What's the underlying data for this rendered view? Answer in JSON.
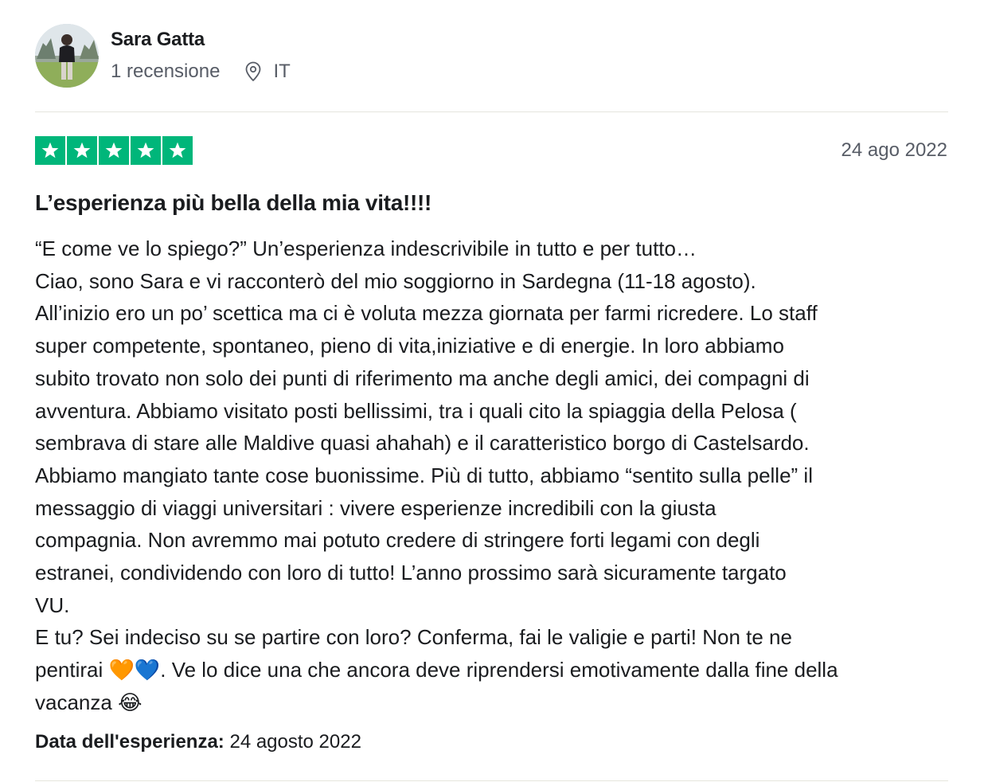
{
  "consumer": {
    "name": "Sara Gatta",
    "review_count": "1 recensione",
    "country": "IT"
  },
  "review": {
    "rating": 5,
    "rating_max": 5,
    "star_color": "#00b67a",
    "date": "24 ago 2022",
    "title": "L’esperienza più bella della mia vita!!!!",
    "body_lines": [
      "“E come ve lo spiego?” Un’esperienza indescrivibile in tutto e per tutto…",
      "Ciao, sono Sara e vi racconterò del mio soggiorno in Sardegna (11-18 agosto).",
      "All’inizio ero un po’ scettica ma ci è voluta mezza giornata per farmi ricredere. Lo staff",
      "super competente, spontaneo, pieno di vita,iniziative e di energie. In loro abbiamo",
      "subito trovato non solo dei punti di riferimento ma anche degli amici, dei compagni di",
      "avventura. Abbiamo visitato posti bellissimi, tra i quali cito la spiaggia della Pelosa (",
      "sembrava di stare alle Maldive quasi ahahah) e il caratteristico borgo di Castelsardo.",
      "Abbiamo mangiato tante cose buonissime. Più di tutto, abbiamo “sentito sulla pelle” il",
      "messaggio di viaggi universitari : vivere esperienze incredibili con la giusta",
      "compagnia. Non avremmo mai potuto credere di stringere forti legami con degli",
      "estranei, condividendo con loro di tutto! L’anno prossimo sarà sicuramente targato",
      "VU.",
      "E tu? Sei indeciso su se partire con loro? Conferma, fai le valigie e parti! Non te ne",
      "pentirai 🧡💙. Ve lo dice una che ancora deve riprendersi emotivamente dalla fine della",
      "vacanza 😂"
    ],
    "experience_label": "Data dell'esperienza:",
    "experience_date": "24 agosto 2022"
  },
  "icons": {
    "location": "location-pin-icon",
    "star": "star-icon"
  }
}
